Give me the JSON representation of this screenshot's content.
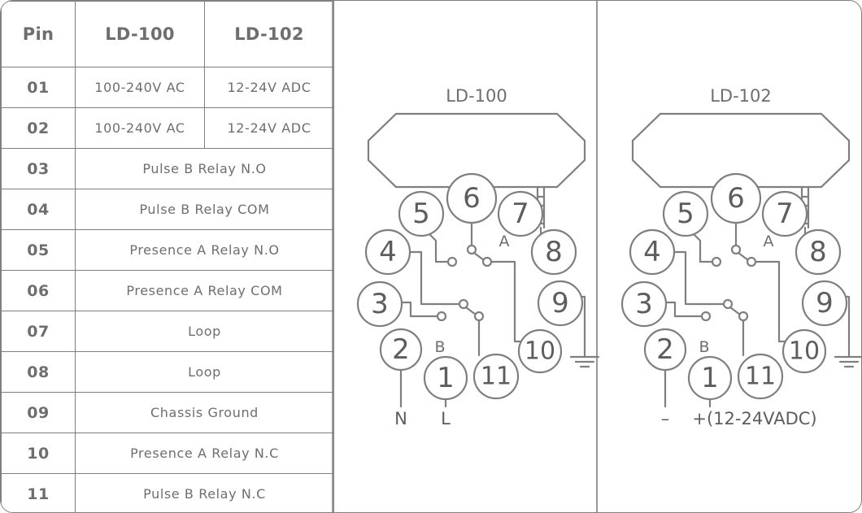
{
  "table": {
    "headers": [
      "Pin",
      "LD-100",
      "LD-102"
    ],
    "rows": [
      {
        "pin": "01",
        "ld100": "100-240V  AC",
        "ld102": "12-24V  ADC",
        "span": false
      },
      {
        "pin": "02",
        "ld100": "100-240V  AC",
        "ld102": "12-24V  ADC",
        "span": false
      },
      {
        "pin": "03",
        "shared": "Pulse B Relay N.O",
        "span": true
      },
      {
        "pin": "04",
        "shared": "Pulse B Relay COM",
        "span": true
      },
      {
        "pin": "05",
        "shared": "Presence A Relay N.O",
        "span": true
      },
      {
        "pin": "06",
        "shared": "Presence A Relay COM",
        "span": true
      },
      {
        "pin": "07",
        "shared": "Loop",
        "span": true
      },
      {
        "pin": "08",
        "shared": "Loop",
        "span": true
      },
      {
        "pin": "09",
        "shared": "Chassis Ground",
        "span": true
      },
      {
        "pin": "10",
        "shared": "Presence A Relay N.C",
        "span": true
      },
      {
        "pin": "11",
        "shared": "Pulse B Relay N.C",
        "span": true
      }
    ]
  },
  "diagrams": [
    {
      "title": "LD-100",
      "relay_a_label": "A",
      "relay_b_label": "B",
      "pins": [
        "1",
        "2",
        "3",
        "4",
        "5",
        "6",
        "7",
        "8",
        "9",
        "10",
        "11"
      ],
      "terminals": [
        {
          "pin": "2",
          "label": "N"
        },
        {
          "pin": "1",
          "label": "L"
        }
      ],
      "ground_pin": "9"
    },
    {
      "title": "LD-102",
      "relay_a_label": "A",
      "relay_b_label": "B",
      "pins": [
        "1",
        "2",
        "3",
        "4",
        "5",
        "6",
        "7",
        "8",
        "9",
        "10",
        "11"
      ],
      "terminals": [
        {
          "pin": "2",
          "label": "–"
        },
        {
          "pin": "1",
          "label": "+(12-24VADC)"
        }
      ],
      "ground_pin": "9"
    }
  ],
  "colors": {
    "stroke": "#7f7f7f",
    "text": "#6e6e6e",
    "numeral": "#5d5d5d",
    "background": "#ffffff"
  }
}
